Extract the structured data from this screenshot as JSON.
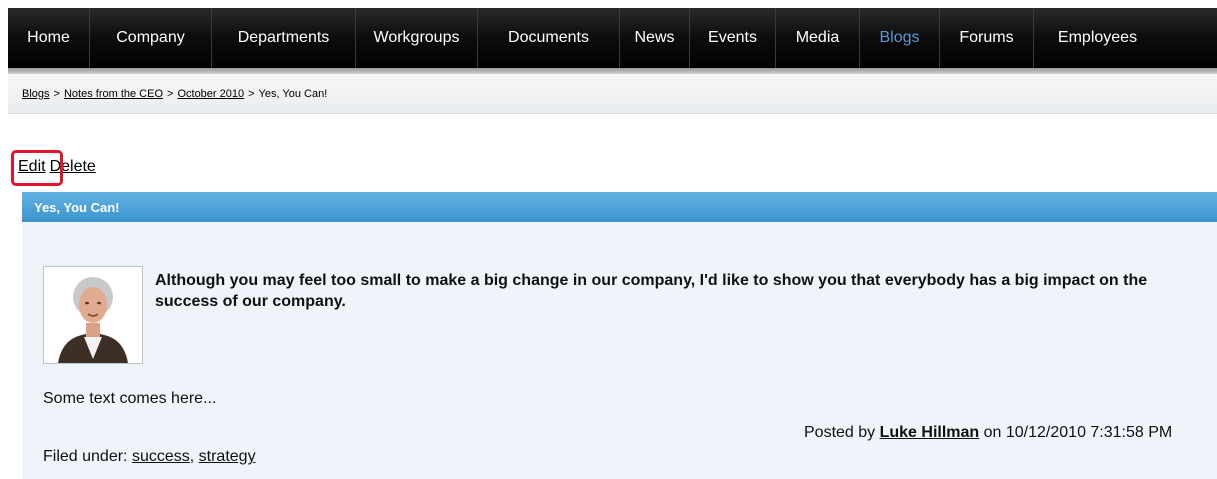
{
  "nav": {
    "items": [
      {
        "label": "Home",
        "width": 82
      },
      {
        "label": "Company",
        "width": 122
      },
      {
        "label": "Departments",
        "width": 144
      },
      {
        "label": "Workgroups",
        "width": 122
      },
      {
        "label": "Documents",
        "width": 142
      },
      {
        "label": "News",
        "width": 70
      },
      {
        "label": "Events",
        "width": 86
      },
      {
        "label": "Media",
        "width": 84
      },
      {
        "label": "Blogs",
        "width": 80
      },
      {
        "label": "Forums",
        "width": 94
      },
      {
        "label": "Employees",
        "width": 127
      }
    ],
    "active": "Blogs"
  },
  "breadcrumb": {
    "items": [
      "Blogs",
      "Notes from the CEO",
      "October 2010"
    ],
    "current": "Yes, You Can!",
    "separator": ">"
  },
  "actions": {
    "edit": "Edit",
    "delete": "Delete"
  },
  "post": {
    "title": "Yes, You Can!",
    "lead": "Although you may feel too small to make a big change in our company, I'd like to show you that everybody has a big impact on the success of our company.",
    "body": "Some text comes here...",
    "posted_prefix": "Posted by",
    "author": "Luke Hillman",
    "posted_suffix": "on 10/12/2010 7:31:58 PM",
    "filed_label": "Filed under:",
    "tags": [
      "success",
      "strategy"
    ]
  },
  "colors": {
    "accent": "#e2162b",
    "header_blue": "#3c93cf",
    "active_nav": "#5f95d6"
  }
}
